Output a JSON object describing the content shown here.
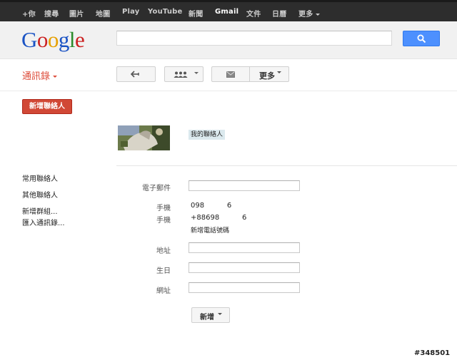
{
  "topbar": {
    "items": [
      {
        "label": "+你"
      },
      {
        "label": "搜尋"
      },
      {
        "label": "圖片"
      },
      {
        "label": "地圖"
      },
      {
        "label": "Play"
      },
      {
        "label": "YouTube"
      },
      {
        "label": "新聞"
      },
      {
        "label": "Gmail"
      },
      {
        "label": "文件"
      },
      {
        "label": "日曆"
      },
      {
        "label": "更多"
      }
    ]
  },
  "header": {
    "logo_letters": [
      "G",
      "o",
      "o",
      "g",
      "l",
      "e"
    ],
    "logo_colors": [
      "#1a53c4",
      "#cc2222",
      "#e6a000",
      "#1a53c4",
      "#2a8a2a",
      "#cc2222"
    ],
    "search_value": ""
  },
  "toolbar": {
    "app_title": "通訊錄",
    "more_label": "更多"
  },
  "left_nav": {
    "new_contact_label": "新增聯絡人",
    "items": [
      {
        "label": "常用聯絡人"
      },
      {
        "label": "其他聯絡人"
      },
      {
        "label": "新增群組..."
      },
      {
        "label": "匯入通訊錄..."
      }
    ]
  },
  "contact": {
    "group_chip": "我的聯絡人",
    "fields": {
      "email_label": "電子郵件",
      "email_value": "",
      "phone1_label": "手機",
      "phone1_value": "098          6",
      "phone2_label": "手機",
      "phone2_value": "+88698          6",
      "add_phone_label": "新增電話號碼",
      "address_label": "地址",
      "address_value": "",
      "birthday_label": "生日",
      "birthday_value": "",
      "website_label": "網址",
      "website_value": ""
    },
    "add_field_label": "新增"
  },
  "watermark": "#348501",
  "colors": {
    "topbar_bg": "#2d2d2d",
    "accent_red": "#dd4b39",
    "search_blue": "#4d90fe",
    "chip_bg": "#dbe9ee"
  }
}
